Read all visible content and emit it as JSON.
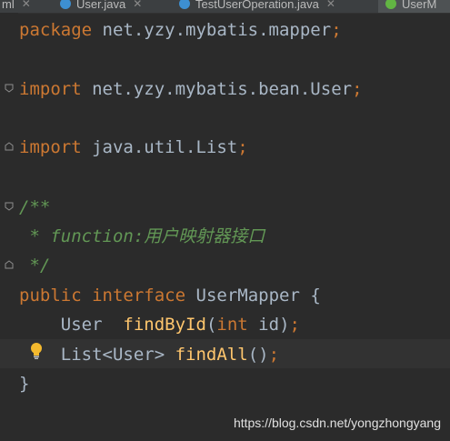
{
  "tabs": [
    {
      "label": "ml",
      "icon": "xml-file-icon"
    },
    {
      "label": "User.java",
      "icon": "java-class-icon"
    },
    {
      "label": "TestUserOperation.java",
      "icon": "java-class-icon"
    },
    {
      "label": "UserM",
      "icon": "java-interface-icon"
    }
  ],
  "code": {
    "package_kw": "package",
    "package_name": "net.yzy.mybatis.mapper",
    "import_kw_1": "import",
    "import_1": "net.yzy.mybatis.bean.User",
    "import_kw_2": "import",
    "import_2": "java.util.List",
    "doc_open": "/**",
    "doc_body_prefix": " * function:",
    "doc_body_text": "用户映射器接口",
    "doc_close": " */",
    "public_kw": "public",
    "interface_kw": "interface",
    "interface_name": "UserMapper",
    "open_brace": "{",
    "m1_type": "User",
    "m1_name": "findById",
    "m1_open": "(",
    "m1_param_type": "int",
    "m1_param_name": "id",
    "m1_close": ")",
    "m2_type": "List<User>",
    "m2_name": "findAll",
    "m2_parens": "()",
    "close_brace": "}",
    "semicolon": ";"
  },
  "watermark": "https://blog.csdn.net/yongzhongyang",
  "colors": {
    "background": "#2b2b2b",
    "keyword": "#cc7832",
    "identifier": "#a9b7c6",
    "method": "#ffc66d",
    "doc_comment": "#629755",
    "caret_line": "#323232"
  }
}
